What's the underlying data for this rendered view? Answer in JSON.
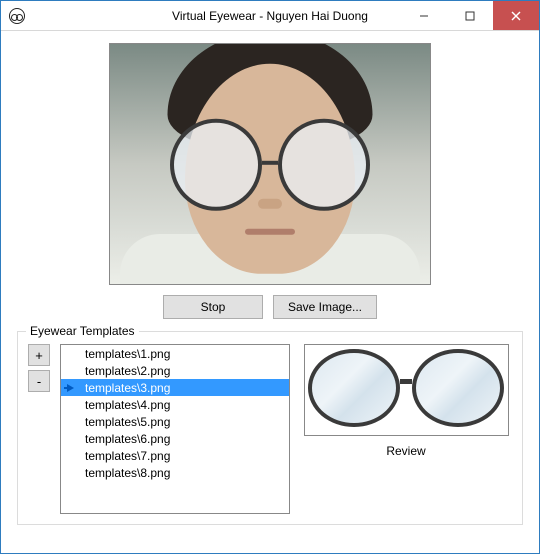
{
  "window": {
    "title": "Virtual Eyewear - Nguyen Hai Duong"
  },
  "buttons": {
    "stop": "Stop",
    "save_image": "Save Image...",
    "add": "+",
    "remove": "-"
  },
  "group": {
    "title": "Eyewear Templates"
  },
  "templates": {
    "items": [
      "templates\\1.png",
      "templates\\2.png",
      "templates\\3.png",
      "templates\\4.png",
      "templates\\5.png",
      "templates\\6.png",
      "templates\\7.png",
      "templates\\8.png"
    ],
    "selected_index": 2
  },
  "preview": {
    "label": "Review"
  }
}
